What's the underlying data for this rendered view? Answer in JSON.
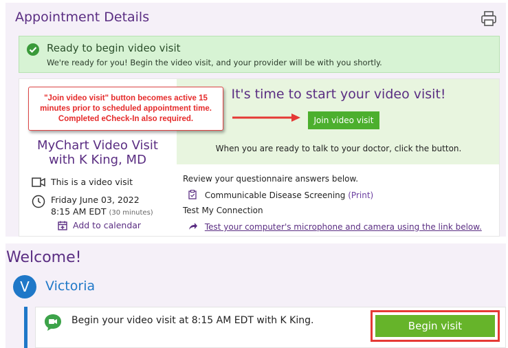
{
  "appointment": {
    "title": "Appointment Details",
    "banner": {
      "title": "Ready to begin video visit",
      "subtitle": "We're ready for you! Begin the video visit, and your provider will be with you shortly."
    },
    "visit_name": "MyChart Video Visit with K King, MD",
    "video_type": "This is a video visit",
    "date": "Friday June 03, 2022",
    "time": "8:15 AM EDT",
    "duration": "(30 minutes)",
    "add_calendar": "Add to calendar",
    "start_title": "It's time to start your video visit!",
    "join_button": "Join video visit",
    "ready_text": "When you are ready to talk to your doctor, click the button.",
    "review_text": "Review your questionnaire answers below.",
    "questionnaire": "Communicable Disease Screening",
    "print_link": "(Print)",
    "test_heading": "Test My Connection",
    "test_link": "Test your computer's microphone and camera using the link below."
  },
  "annotation": {
    "line1": "\"Join video visit\" button becomes active 15",
    "line2": "minutes prior to scheduled appointment time.",
    "line3": "Completed eCheck-In also required."
  },
  "welcome": {
    "title": "Welcome!",
    "avatar_initial": "V",
    "user_name": "Victoria",
    "visit_text": "Begin your video visit at 8:15 AM EDT with K King.",
    "begin_button": "Begin visit"
  },
  "colors": {
    "brand_purple": "#5a2d82",
    "success_green": "#4caf2e",
    "banner_green": "#d7f3d4",
    "accent_blue": "#1f78c8",
    "alert_red": "#e53935"
  },
  "icons": [
    "print-icon",
    "check-circle-icon",
    "video-camera-icon",
    "clock-icon",
    "calendar-icon",
    "clipboard-icon",
    "arrow-share-icon",
    "chat-video-icon"
  ]
}
